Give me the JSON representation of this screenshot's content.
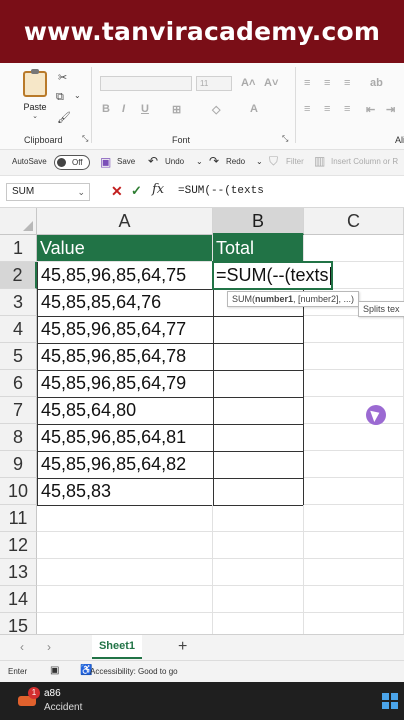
{
  "banner": {
    "text": "www.tanviracademy.com"
  },
  "ribbon": {
    "paste_label": "Paste",
    "clipboard_label": "Clipboard",
    "font_label": "Font",
    "alignment_label": "Ali",
    "font_size": "11"
  },
  "qat": {
    "autosave_label": "AutoSave",
    "autosave_state": "Off",
    "save_label": "Save",
    "undo_label": "Undo",
    "redo_label": "Redo",
    "filter_label": "Filter",
    "insert_label": "Insert Column or R"
  },
  "formula_bar": {
    "name_box": "SUM",
    "formula": "=SUM(--(texts"
  },
  "grid": {
    "columns": [
      "A",
      "B",
      "C"
    ],
    "rows": [
      "1",
      "2",
      "3",
      "4",
      "5",
      "6",
      "7",
      "8",
      "9",
      "10",
      "11",
      "12",
      "13",
      "14",
      "15"
    ],
    "cells": {
      "A1": "Value",
      "B1": "Total",
      "A2": "45,85,96,85,64,75",
      "A3": "45,85,85,64,76",
      "A4": "45,85,96,85,64,77",
      "A5": "45,85,96,85,64,78",
      "A6": "45,85,96,85,64,79",
      "A7": "45,85,64,80",
      "A8": "45,85,96,85,64,81",
      "A9": "45,85,96,85,64,82",
      "A10": "45,85,83"
    },
    "active_cell_text": "=SUM(--(texts",
    "tooltip_fn": "SUM(",
    "tooltip_arg1": "number1",
    "tooltip_rest": ", [number2], ...)",
    "tooltip_splits": "Splits tex"
  },
  "sheet_tabs": {
    "active": "Sheet1"
  },
  "status_bar": {
    "mode": "Enter",
    "accessibility": "Accessibility: Good to go"
  },
  "taskbar": {
    "badge": "1",
    "title": "a86",
    "subtitle": "Accident"
  }
}
